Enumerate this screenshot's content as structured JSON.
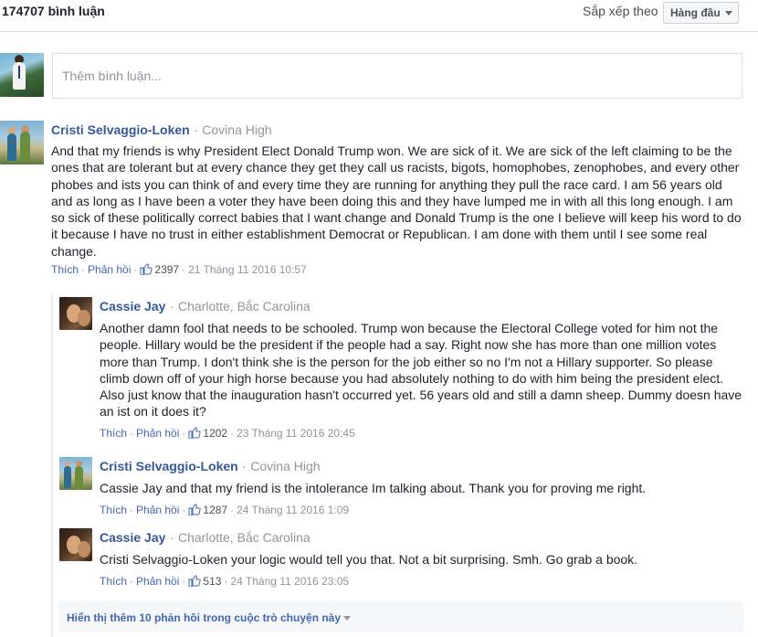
{
  "header": {
    "comment_count": "174707 bình luận",
    "sort_label": "Sắp xếp theo",
    "sort_value": "Hàng đầu"
  },
  "composer": {
    "placeholder": "Thêm bình luận..."
  },
  "comments": [
    {
      "author": "Cristi Selvaggio-Loken",
      "school": "Covina High",
      "text": "And that my friends is why President Elect Donald Trump won. We are sick of it. We are sick of the left claiming to be the ones that are tolerant but at every chance they get they call us racists, bigots, homophobes, zenophobes, and every other phobes and ists you can think of and every time they are running for anything they pull the race card. I am 56 years old and as long as I have been a voter they have been doing this and they have lumped me in with all this long enough. I am so sick of these politically correct babies that I want change and Donald Trump is the one I believe will keep his word to do it because I have no trust in either establishment Democrat or Republican. I am done with them until I see some real change.",
      "like_label": "Thích",
      "reply_label": "Phản hồi",
      "likes": "2397",
      "time": "21 Tháng 11 2016 10:57"
    }
  ],
  "replies": [
    {
      "author": "Cassie Jay",
      "school": "Charlotte, Bắc Carolina",
      "text": "Another damn fool that needs to be schooled. Trump won because the Electoral College voted for him not the people. Hillary would be the president if the people had a say. Right now she has more than one million votes more than Trump. I don't think she is the person for the job either so no I'm not a Hillary supporter. So please climb down off of your high horse because you had absolutely nothing to do with him being the president elect. Also just know that the inauguration hasn't occurred yet. 56 years old and still a damn sheep. Dummy doesn have an ist on it does it?",
      "like_label": "Thích",
      "reply_label": "Phản hồi",
      "likes": "1202",
      "time": "23 Tháng 11 2016 20:45"
    },
    {
      "author": "Cristi Selvaggio-Loken",
      "school": "Covina High",
      "text": "Cassie Jay and that my friend is the intolerance Im talking about. Thank you for proving me right.",
      "like_label": "Thích",
      "reply_label": "Phản hồi",
      "likes": "1287",
      "time": "24 Tháng 11 2016 1:09"
    },
    {
      "author": "Cassie Jay",
      "school": "Charlotte, Bắc Carolina",
      "text": "Cristi Selvaggio-Loken your logic would tell you that. Not a bit surprising. Smh. Go grab a book.",
      "like_label": "Thích",
      "reply_label": "Phản hồi",
      "likes": "513",
      "time": "24 Tháng 11 2016 23:05"
    }
  ],
  "more_replies": "Hiển thị thêm 10 phản hồi trong cuộc trò chuyện này",
  "colors": {
    "link": "#4267b2",
    "author": "#365899",
    "meta": "#90949c"
  },
  "icons": {
    "like": "thumbs-up-icon",
    "sort": "chevron-down-icon"
  }
}
